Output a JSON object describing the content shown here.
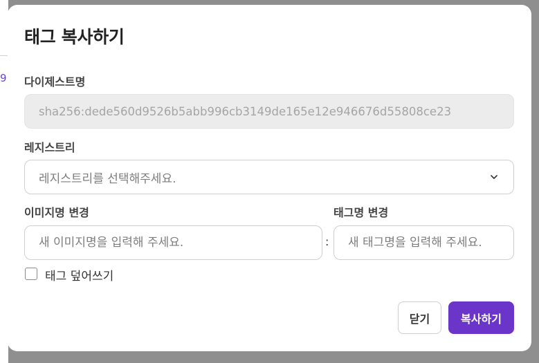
{
  "background": {
    "partial_text": "9"
  },
  "dialog": {
    "title": "태그 복사하기",
    "digest": {
      "label": "다이제스트명",
      "value": "sha256:dede560d9526b5abb996cb3149de165e12e946676d55808ce23"
    },
    "registry": {
      "label": "레지스트리",
      "placeholder": "레지스트리를 선택해주세요.",
      "icon": "chevron-down-icon"
    },
    "image_name": {
      "label": "이미지명 변경",
      "placeholder": "새 이미지명을 입력해 주세요."
    },
    "separator": ":",
    "tag_name": {
      "label": "태그명 변경",
      "placeholder": "새 태그명을 입력해 주세요."
    },
    "overwrite": {
      "label": "태그 덮어쓰기",
      "checked": false
    },
    "buttons": {
      "close": "닫기",
      "copy": "복사하기"
    }
  },
  "colors": {
    "accent": "#6c35c9",
    "overlay": "#8f8f8f",
    "link": "#6d3fd4"
  }
}
